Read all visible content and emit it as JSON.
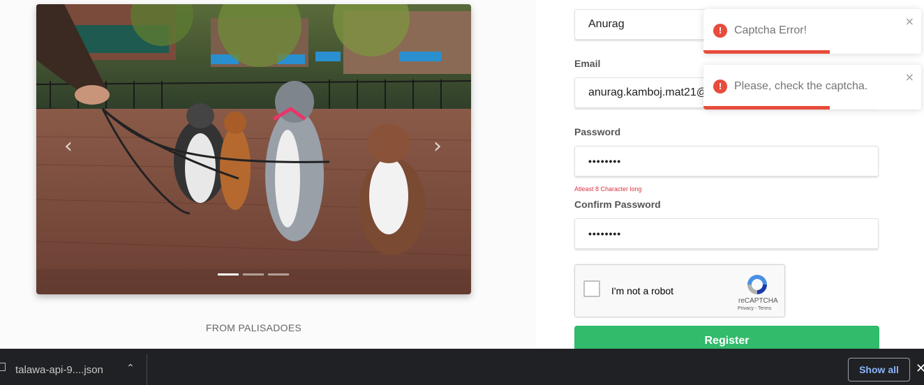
{
  "carousel": {
    "caption": "FROM PALISADOES",
    "slides": 3,
    "active_slide": 1,
    "prev_glyph": "‹",
    "next_glyph": "›"
  },
  "form": {
    "name_value": "Anurag",
    "email_label": "Email",
    "email_value": "anurag.kamboj.mat21@",
    "password_label": "Password",
    "password_value": "••••••••",
    "password_hint": "Atleast 8 Character long",
    "confirm_label": "Confirm Password",
    "confirm_value": "••••••••",
    "register_label": "Register"
  },
  "recaptcha": {
    "label": "I'm not a robot",
    "brand": "reCAPTCHA",
    "terms": "Privacy - Terms"
  },
  "toasts": [
    {
      "message": "Captcha Error!",
      "icon": "exclamation-icon",
      "progress": 0.58
    },
    {
      "message": "Please, check the captcha.",
      "icon": "exclamation-icon",
      "progress": 0.58
    }
  ],
  "download_bar": {
    "filename": "talawa-api-9....json",
    "show_all_label": "Show all",
    "close_glyph": "✕",
    "chevron_glyph": "^"
  },
  "colors": {
    "accent_green": "#31bb6b",
    "error_red": "#e74c3c",
    "hint_red": "#dc3545",
    "download_bar_bg": "#202124",
    "show_all_text": "#8ab4f8"
  }
}
